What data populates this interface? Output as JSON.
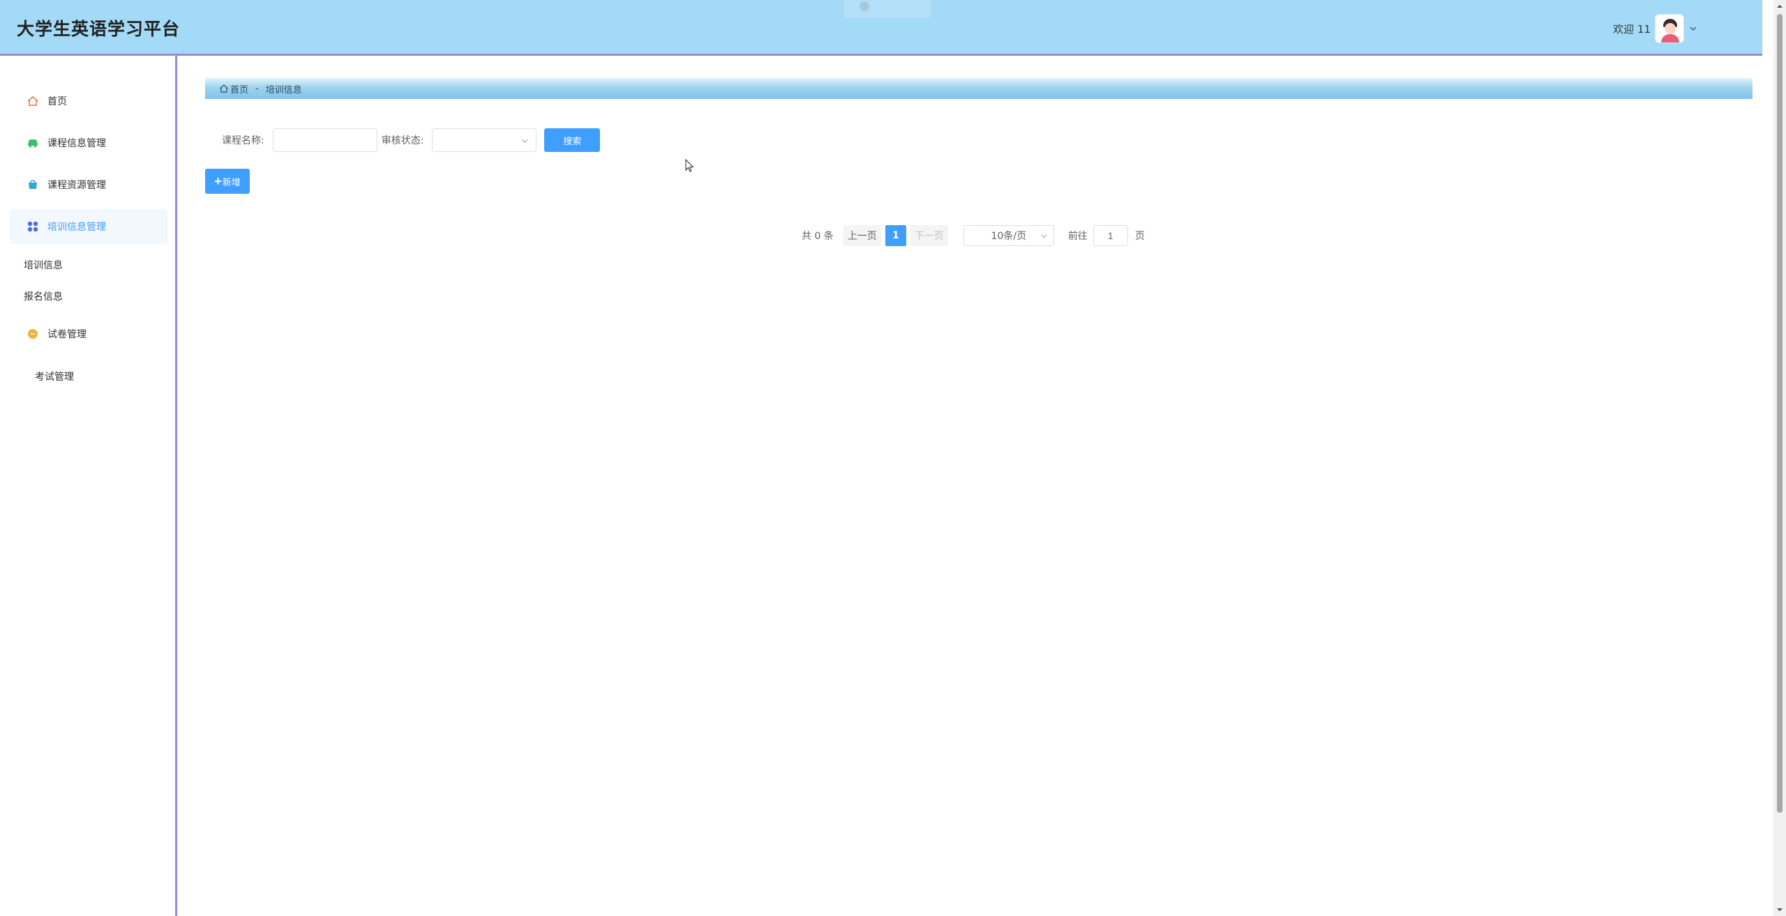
{
  "header": {
    "title": "大学生英语学习平台",
    "welcome": "欢迎 11",
    "avatar_icon": "user-avatar-icon",
    "dropdown_icon": "chevron-down-icon"
  },
  "sidebar": {
    "items": [
      {
        "label": "首页",
        "icon": "home-icon",
        "color": "#e07050"
      },
      {
        "label": "课程信息管理",
        "icon": "car-icon",
        "color": "#3fbf6a"
      },
      {
        "label": "课程资源管理",
        "icon": "basket-icon",
        "color": "#2fa8d6"
      },
      {
        "label": "培训信息管理",
        "icon": "apps-icon",
        "color": "#4a6ee0",
        "active": true
      },
      {
        "label": "试卷管理",
        "icon": "coin-icon",
        "color": "#e9b640"
      }
    ],
    "subitems": [
      "培训信息",
      "报名信息"
    ],
    "exam_label": "考试管理"
  },
  "breadcrumb": {
    "home": "首页",
    "separator": "-",
    "current": "培训信息"
  },
  "search": {
    "course_name_label": "课程名称:",
    "course_name_value": "",
    "status_label": "审核状态:",
    "status_value": "",
    "search_button": "搜索"
  },
  "actions": {
    "add_label": "新增"
  },
  "pagination": {
    "total": "共 0 条",
    "prev": "上一页",
    "current_page": "1",
    "next": "下一页",
    "page_size": "10条/页",
    "goto_label": "前往",
    "goto_value": "1",
    "page_suffix": "页"
  },
  "colors": {
    "header_bg": "#a3daf7",
    "accent": "#409eff",
    "divider": "#9a89d4"
  }
}
